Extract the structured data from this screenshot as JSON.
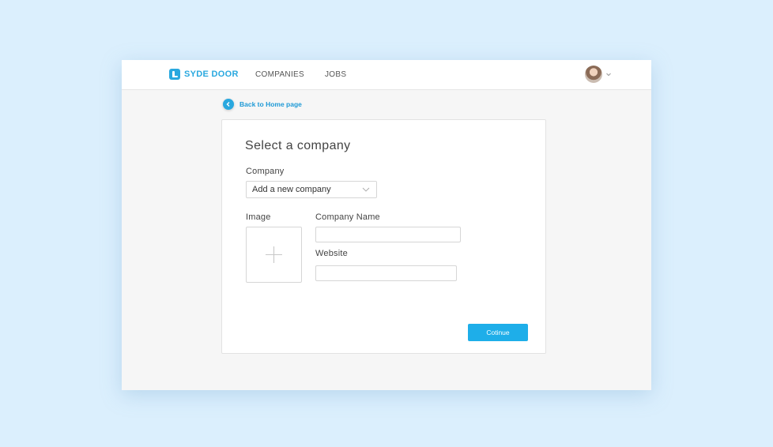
{
  "navbar": {
    "brand": "SYDE DOOR",
    "links": [
      "COMPANIES",
      "JOBS"
    ],
    "user_avatar_icon": "user-avatar",
    "user_menu_icon": "chevron-down-icon"
  },
  "back_link": {
    "label": "Back to Home page",
    "icon": "chevron-left-icon"
  },
  "form": {
    "title": "Select a company",
    "company_label": "Company",
    "company_select_value": "Add a new company",
    "image_label": "Image",
    "company_name_label": "Company Name",
    "company_name_value": "",
    "website_label": "Website",
    "website_value": "",
    "continue_label": "Cotinue"
  },
  "colors": {
    "page_bg": "#dbeffd",
    "accent": "#29a8df",
    "button_bg": "#1eaee9"
  }
}
